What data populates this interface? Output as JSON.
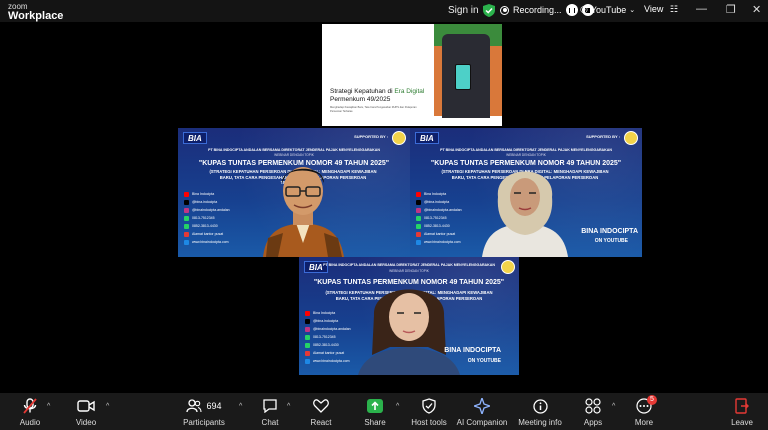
{
  "app": {
    "brand_top": "zoom",
    "brand_main": "Workplace",
    "signin": "Sign in",
    "recording_label": "Recording...",
    "youtube_label": "YouTube",
    "view_label": "View"
  },
  "shared_slide": {
    "title_prefix": "Strategi Kepatuhan di ",
    "title_highlight": "Era Digital",
    "title_suffix": " Permenkum 49/2025",
    "subtitle": "Menghadapi Kewajiban Baru, Tata Cara Pengesahan RUPS dan Pelaporan Perseroan Terbatas"
  },
  "banner": {
    "logo": "BIA",
    "supported_by": "SUPPORTED BY :",
    "organizer": "PT BINA INDOCIPTA ANDALAN BERSAMA DIREKTORAT JENDERAL PAJAK MENYELENGGARAKAN",
    "webinar": "WEBINAR DENGAN TOPIK",
    "headline": "\"KUPAS TUNTAS PERMENKUM NOMOR 49 TAHUN 2025\"",
    "detail": "(STRATEGI KEPATUHAN PERSEROAN DI ERA DIGITAL: MENGHADAPI KEWAJIBAN BARU, TATA CARA PENGESAHAN RUPS DAN PELAPORAN PERSEROAN TERBATAS).",
    "social": [
      "Bina Indocipta",
      "@bina.indocipta",
      "@binaindocipta.andalan",
      "0813-7512345",
      "0852-3813-4430",
      "Alamat kantor pusat",
      "www.binaindocipta.com"
    ],
    "footer_main": "BINA INDOCIPTA",
    "footer_sub": "ON YOUTUBE"
  },
  "toolbar": {
    "audio": "Audio",
    "video": "Video",
    "participants_count": "694",
    "participants": "Participants",
    "chat": "Chat",
    "react": "React",
    "share": "Share",
    "host_tools": "Host tools",
    "ai_companion": "AI Companion",
    "meeting_info": "Meeting info",
    "apps": "Apps",
    "more": "More",
    "more_badge": "5",
    "leave": "Leave"
  }
}
